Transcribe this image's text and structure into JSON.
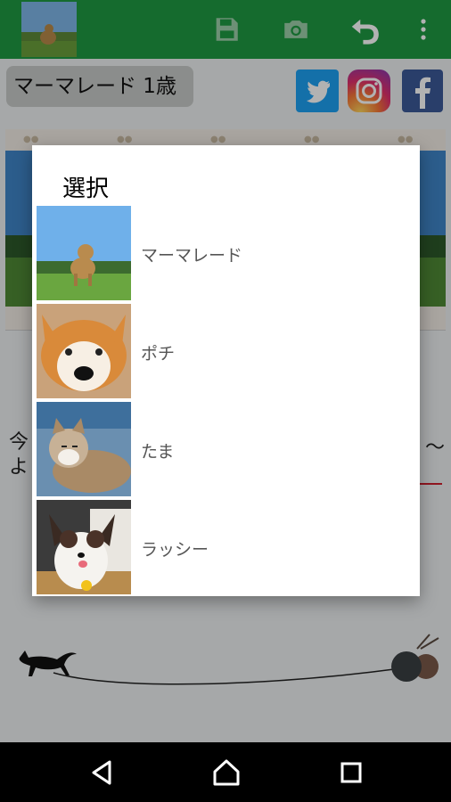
{
  "app": {
    "pet_name_badge": "マーマレード 1歳",
    "toolbar_icons": [
      "save-icon",
      "camera-icon",
      "undo-icon",
      "more-vert-icon"
    ],
    "social_icons": [
      "twitter-icon",
      "instagram-icon",
      "facebook-icon"
    ],
    "background_text_line1_start": "今",
    "background_text_line2_start": "よ",
    "background_text_line1_end": "〜",
    "colors": {
      "appbar": "#1f9a43",
      "twitter": "#1da1f2",
      "facebook": "#3b5998",
      "accent_red": "#d0202f"
    }
  },
  "dialog": {
    "title": "選択",
    "pets": [
      {
        "name": "マーマレード",
        "thumb": "dog-on-grass-photo"
      },
      {
        "name": "ポチ",
        "thumb": "shiba-dog-photo"
      },
      {
        "name": "たま",
        "thumb": "tabby-cat-photo"
      },
      {
        "name": "ラッシー",
        "thumb": "papillon-dog-photo"
      }
    ]
  },
  "navbar": {
    "buttons": [
      "back-icon",
      "home-icon",
      "recents-icon"
    ]
  }
}
